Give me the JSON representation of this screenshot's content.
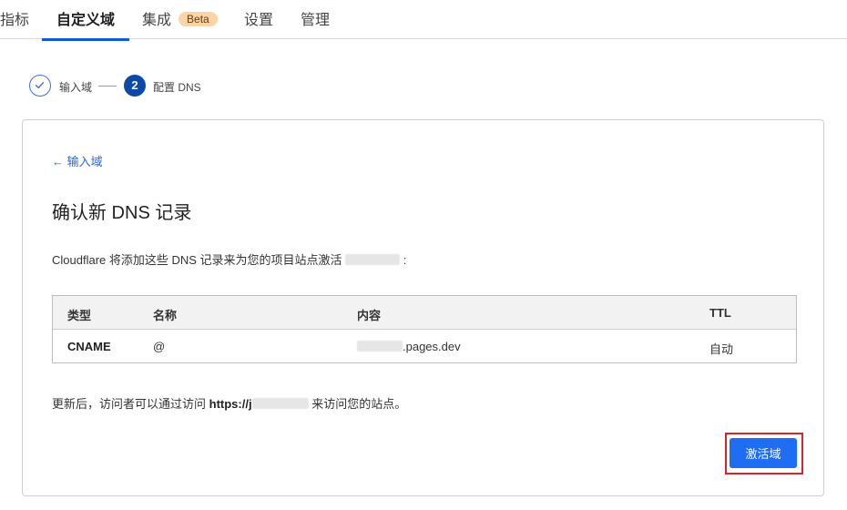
{
  "tabs": [
    {
      "label": "指标"
    },
    {
      "label": "自定义域"
    },
    {
      "label": "集成",
      "badge": "Beta"
    },
    {
      "label": "设置"
    },
    {
      "label": "管理"
    }
  ],
  "stepper": {
    "steps": [
      {
        "label": "输入域",
        "state": "done"
      },
      {
        "number": "2",
        "label": "配置 DNS",
        "state": "current"
      }
    ]
  },
  "card": {
    "back_link": "← 输入域",
    "title": "确认新 DNS 记录",
    "description_prefix": "Cloudflare 将添加这些 DNS 记录来为您的项目站点激活",
    "description_suffix": ":",
    "table": {
      "headers": [
        "类型",
        "名称",
        "内容",
        "TTL"
      ],
      "rows": [
        {
          "type": "CNAME",
          "name": "@",
          "content_suffix": ".pages.dev",
          "ttl": "自动"
        }
      ]
    },
    "footnote_prefix": "更新后，访问者可以通过访问",
    "footnote_url_prefix": "https://j",
    "footnote_suffix": "来访问您的站点。",
    "activate_button": "激活域"
  },
  "colors": {
    "accent": "#1e6df2",
    "tab_indicator": "#0b5bd3",
    "badge_bg": "#fbd4a8",
    "highlight_border": "#d9232e"
  }
}
